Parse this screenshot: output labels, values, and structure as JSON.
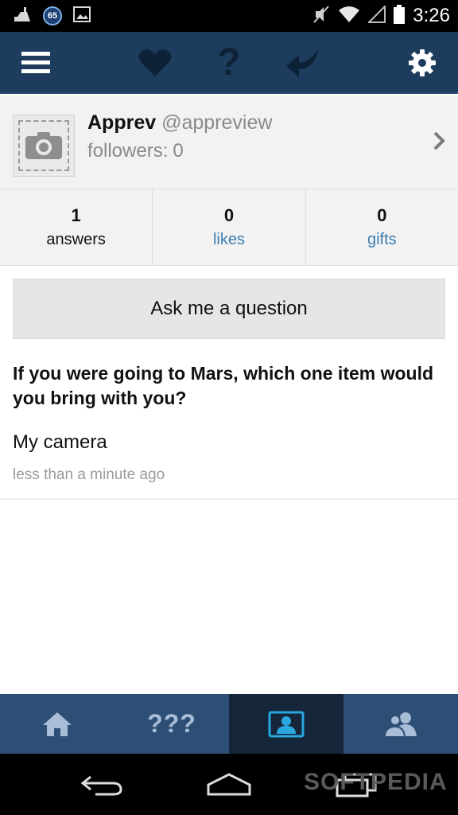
{
  "status_bar": {
    "battery_badge": "65",
    "time": "3:26"
  },
  "action_bar": {
    "question_mark": "?"
  },
  "profile": {
    "name": "Apprev",
    "handle": "@appreview",
    "followers_label": "followers:",
    "followers_count": "0"
  },
  "stats": [
    {
      "value": "1",
      "label": "answers"
    },
    {
      "value": "0",
      "label": "likes"
    },
    {
      "value": "0",
      "label": "gifts"
    }
  ],
  "ask_button": {
    "label": "Ask me a question"
  },
  "post": {
    "question": "If you were going to Mars, which one item would you bring with you?",
    "answer": "My camera",
    "timestamp": "less than a minute ago"
  },
  "bottom_tabs": {
    "questions_label": "???"
  },
  "watermark": "SOFTPEDIA",
  "colors": {
    "action_bar": "#1e3c5e",
    "bottom_bar": "#2d4f76",
    "accent_blue": "#3d7eb0",
    "active_icon": "#29a8e0"
  }
}
